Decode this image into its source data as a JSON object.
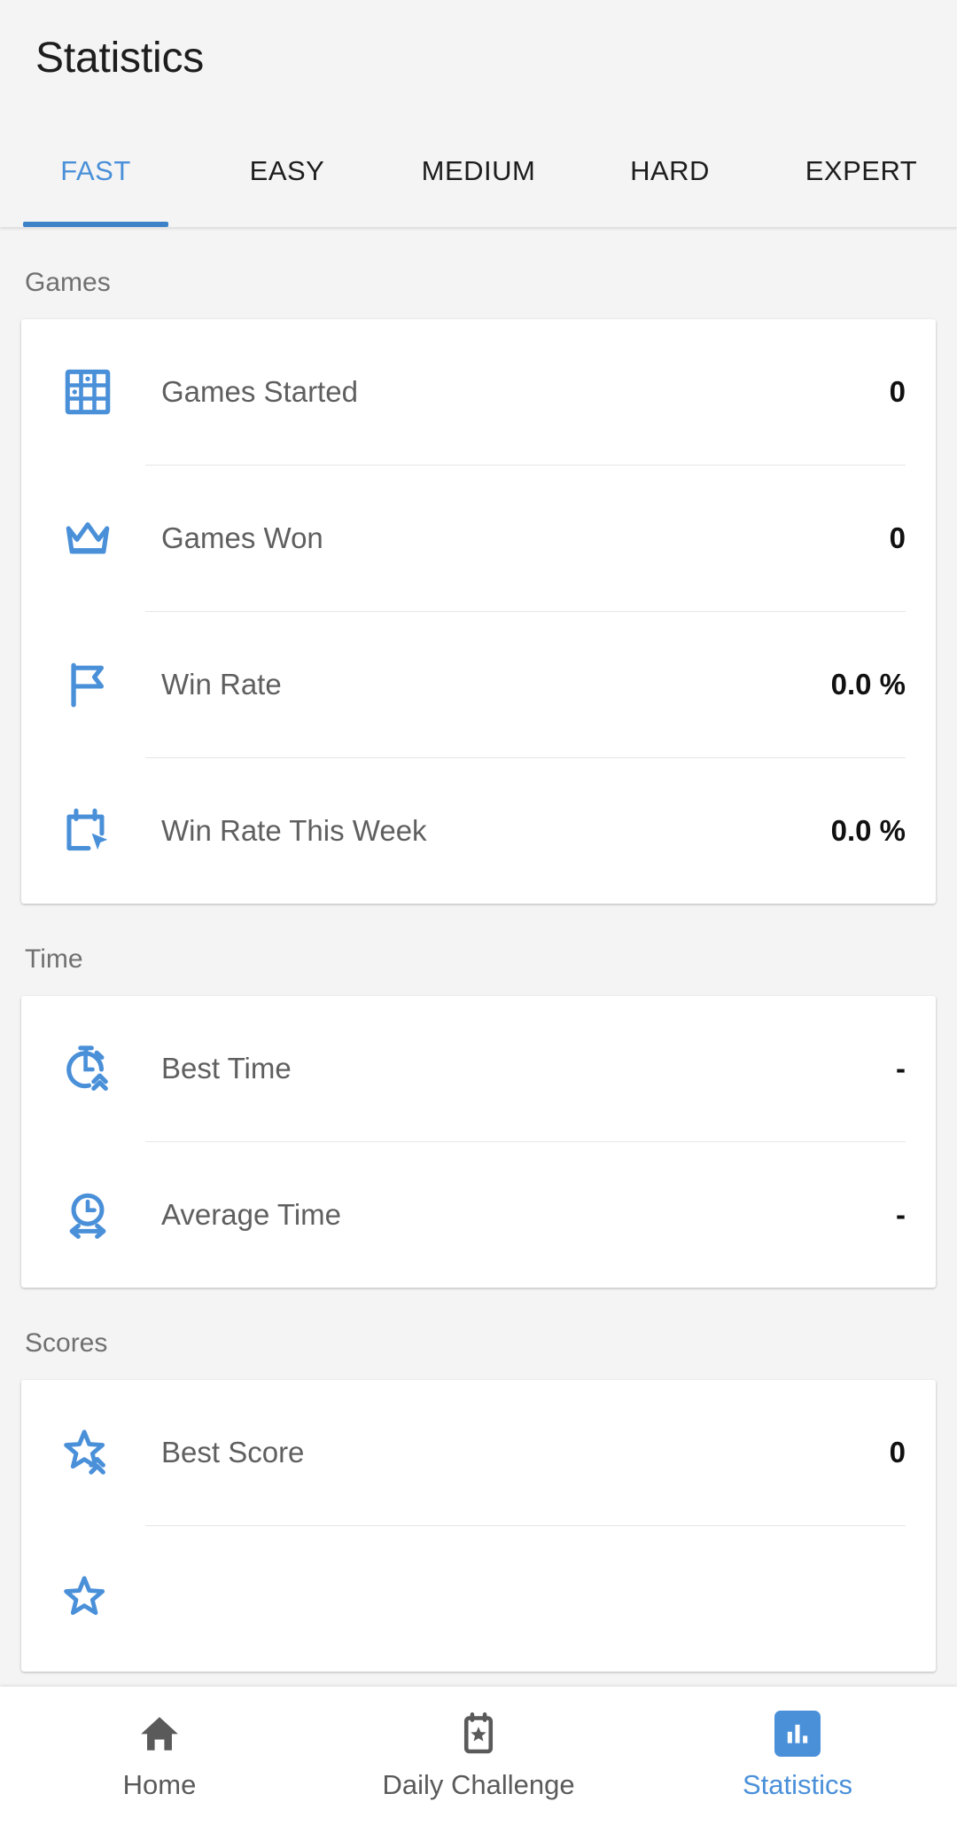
{
  "header": {
    "title": "Statistics"
  },
  "tabs": [
    {
      "label": "FAST",
      "active": true
    },
    {
      "label": "EASY",
      "active": false
    },
    {
      "label": "MEDIUM",
      "active": false
    },
    {
      "label": "HARD",
      "active": false
    },
    {
      "label": "EXPERT",
      "active": false
    }
  ],
  "sections": [
    {
      "label": "Games",
      "rows": [
        {
          "icon": "sudoku-grid-icon",
          "label": "Games Started",
          "value": "0"
        },
        {
          "icon": "crown-icon",
          "label": "Games Won",
          "value": "0"
        },
        {
          "icon": "flag-icon",
          "label": "Win Rate",
          "value": "0.0 %"
        },
        {
          "icon": "calendar-cursor-icon",
          "label": "Win Rate This Week",
          "value": "0.0 %"
        }
      ]
    },
    {
      "label": "Time",
      "rows": [
        {
          "icon": "stopwatch-up-icon",
          "label": "Best Time",
          "value": "-"
        },
        {
          "icon": "clock-arrows-icon",
          "label": "Average Time",
          "value": "-"
        }
      ]
    },
    {
      "label": "Scores",
      "rows": [
        {
          "icon": "star-up-icon",
          "label": "Best Score",
          "value": "0"
        }
      ]
    }
  ],
  "bottom_nav": [
    {
      "icon": "home-icon",
      "label": "Home",
      "active": false
    },
    {
      "icon": "calendar-star-icon",
      "label": "Daily Challenge",
      "active": false
    },
    {
      "icon": "bar-chart-icon",
      "label": "Statistics",
      "active": true
    }
  ],
  "colors": {
    "accent": "#4a90d9",
    "underline": "#3d82c8",
    "background": "#f4f4f4",
    "card": "#ffffff"
  }
}
